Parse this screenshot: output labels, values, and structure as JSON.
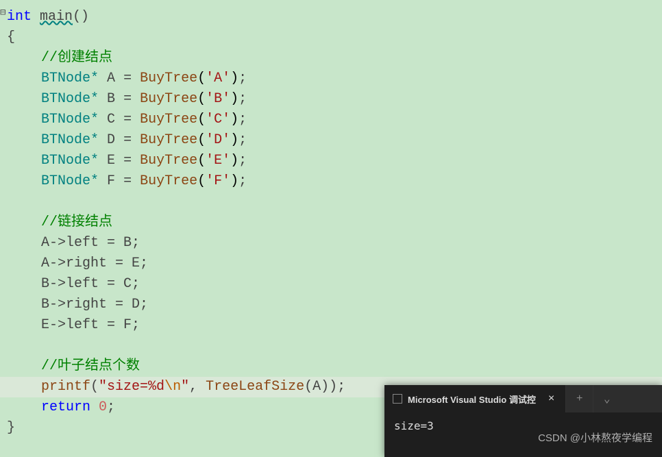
{
  "code": {
    "fn_sig_kw": "int ",
    "fn_name": "main",
    "fn_parens": "()",
    "open_brace": "{",
    "comment_create": "//创建结点",
    "node_decls": [
      {
        "type": "BTNode",
        "ptr": "*",
        "var": "A",
        "eq": " = ",
        "call": "BuyTree",
        "arg": "'A'",
        "end": ";"
      },
      {
        "type": "BTNode",
        "ptr": "*",
        "var": "B",
        "eq": " = ",
        "call": "BuyTree",
        "arg": "'B'",
        "end": ";"
      },
      {
        "type": "BTNode",
        "ptr": "*",
        "var": "C",
        "eq": " = ",
        "call": "BuyTree",
        "arg": "'C'",
        "end": ";"
      },
      {
        "type": "BTNode",
        "ptr": "*",
        "var": "D",
        "eq": " = ",
        "call": "BuyTree",
        "arg": "'D'",
        "end": ";"
      },
      {
        "type": "BTNode",
        "ptr": "*",
        "var": "E",
        "eq": " = ",
        "call": "BuyTree",
        "arg": "'E'",
        "end": ";"
      },
      {
        "type": "BTNode",
        "ptr": "*",
        "var": "F",
        "eq": " = ",
        "call": "BuyTree",
        "arg": "'F'",
        "end": ";"
      }
    ],
    "comment_link": "//链接结点",
    "links": [
      "A->left = B;",
      "A->right = E;",
      "B->left = C;",
      "B->right = D;",
      "E->left = F;"
    ],
    "comment_leaf": "//叶子结点个数",
    "printf_fn": "printf",
    "printf_open": "(",
    "printf_str_open": "\"",
    "printf_str_body": "size=%d",
    "printf_esc": "\\n",
    "printf_str_close": "\"",
    "printf_comma": ", ",
    "printf_call": "TreeLeafSize",
    "printf_arg": "(A))",
    "printf_end": ";",
    "return_kw": "return ",
    "return_val": "0",
    "return_end": ";",
    "close_brace": "}"
  },
  "console": {
    "tab_title": "Microsoft Visual Studio 调试控",
    "output": "size=3",
    "plus": "+",
    "chevron": "⌄",
    "close": "×"
  },
  "watermark": "CSDN @小林熬夜学编程"
}
